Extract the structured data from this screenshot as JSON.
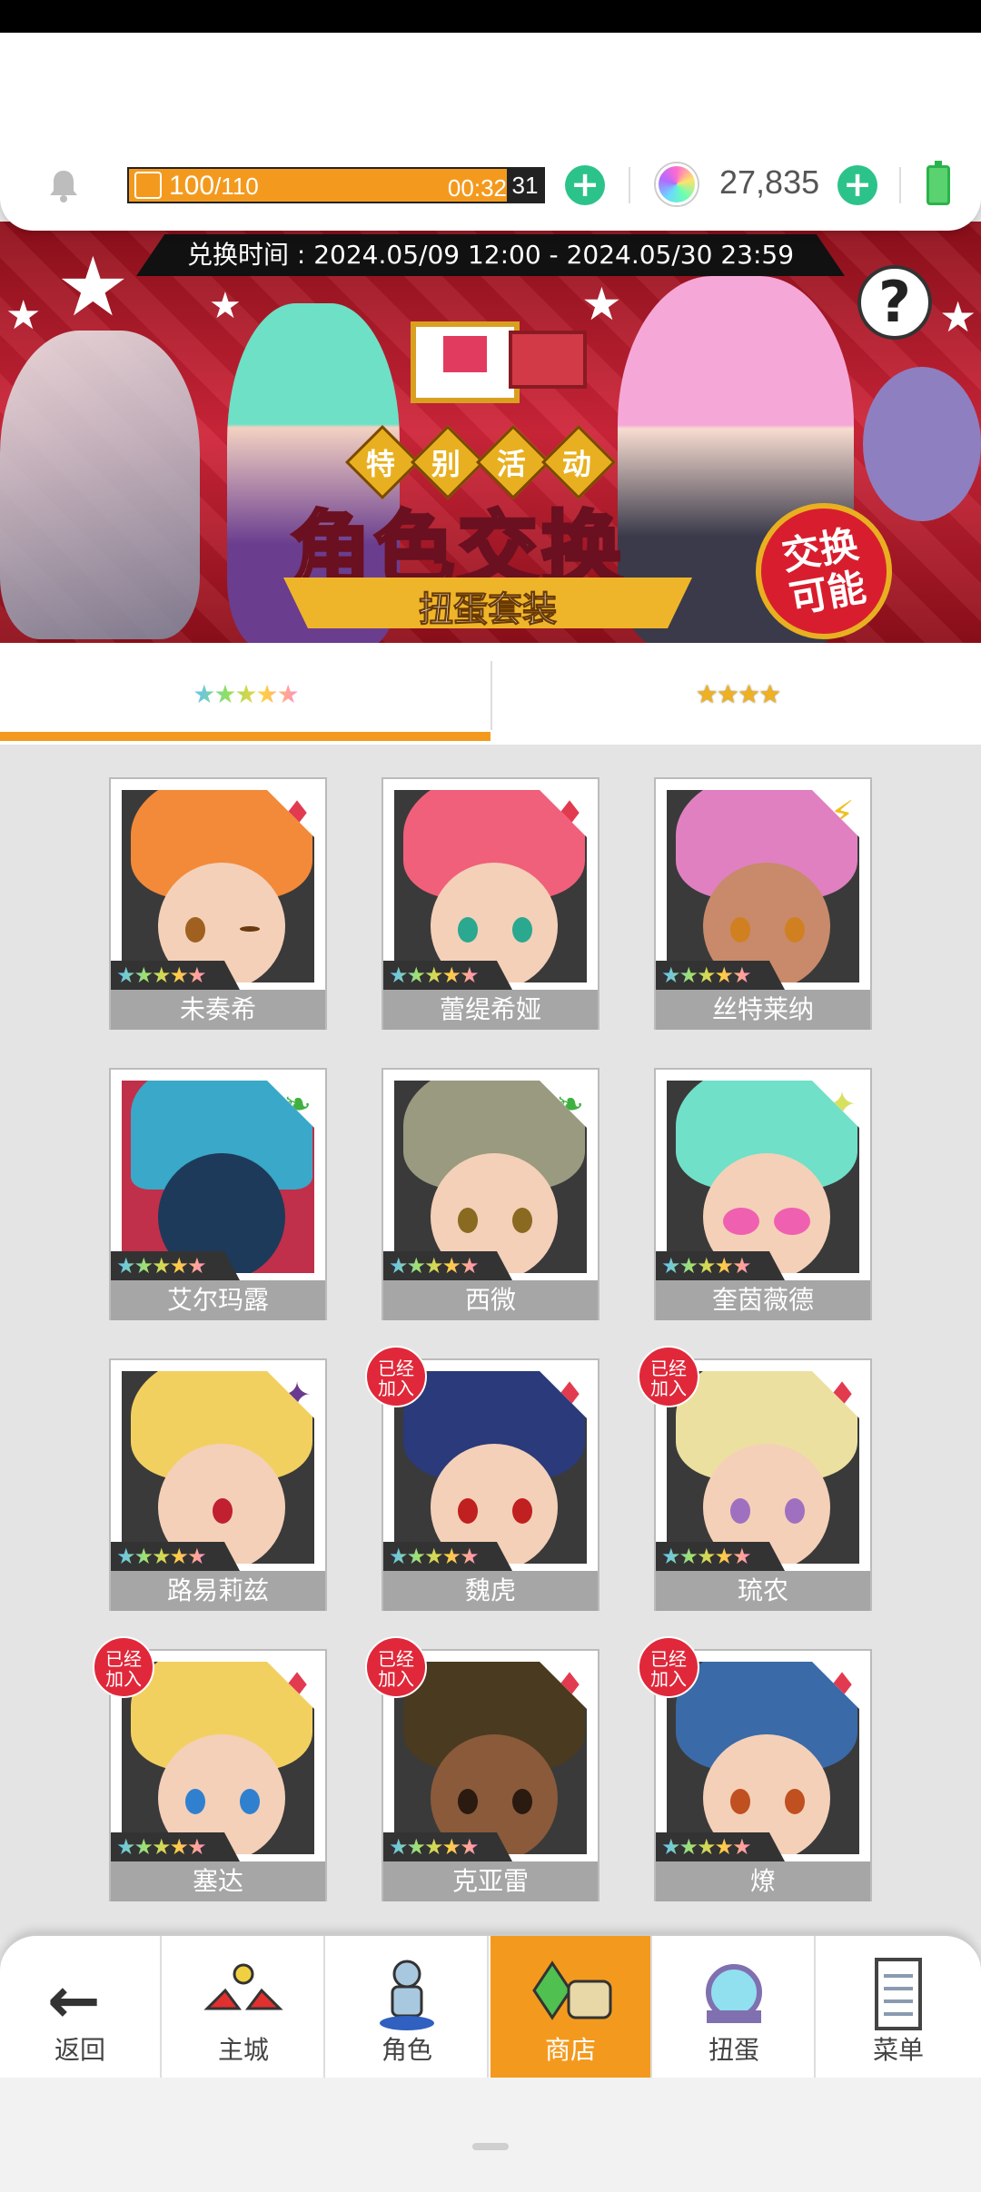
{
  "header": {
    "stamina_current": "100",
    "stamina_max": "/110",
    "stamina_timer": "00:32",
    "stamina_timer_sec": "31",
    "gems": "27,835",
    "stamina_icon": "lightning-icon",
    "notification_icon": "bell-icon",
    "gem_icon": "rainbow-gem-icon",
    "battery_icon": "battery-icon"
  },
  "banner": {
    "exchange_time": "兑换时间 : 2024.05/09 12:00 - 2024.05/30 23:59",
    "tags": [
      "特",
      "别",
      "活",
      "动"
    ],
    "title": "角色交换",
    "subtitle": "扭蛋套装",
    "badge_line1": "交换",
    "badge_line2": "可能",
    "help_label": "?"
  },
  "tabs": [
    {
      "label": "★★★★★",
      "rarity": 5,
      "active": true
    },
    {
      "label": "★★★★",
      "rarity": 4,
      "active": false
    }
  ],
  "characters": [
    {
      "name": "未奏希",
      "stars": "★★★★★",
      "element": "♦",
      "joined": false
    },
    {
      "name": "蕾缇希娅",
      "stars": "★★★★★",
      "element": "♦",
      "joined": false
    },
    {
      "name": "丝特莱纳",
      "stars": "★★★★★",
      "element": "⚡",
      "joined": false
    },
    {
      "name": "艾尔玛露",
      "stars": "★★★★★",
      "element": "❧",
      "joined": false
    },
    {
      "name": "西微",
      "stars": "★★★★★",
      "element": "❧",
      "joined": false
    },
    {
      "name": "奎茵薇德",
      "stars": "★★★★★",
      "element": "✦",
      "joined": false
    },
    {
      "name": "路易莉兹",
      "stars": "★★★★★",
      "element": "✦",
      "joined": false
    },
    {
      "name": "魏虎",
      "stars": "★★★★★",
      "element": "♦",
      "joined": true,
      "joined_label": "已经加入"
    },
    {
      "name": "琉农",
      "stars": "★★★★★",
      "element": "♦",
      "joined": true,
      "joined_label": "已经加入"
    },
    {
      "name": "塞达",
      "stars": "★★★★★",
      "element": "♦",
      "joined": true,
      "joined_label": "已经加入"
    },
    {
      "name": "克亚雷",
      "stars": "★★★★★",
      "element": "♦",
      "joined": true,
      "joined_label": "已经加入"
    },
    {
      "name": "燎",
      "stars": "★★★★★",
      "element": "♦",
      "joined": true,
      "joined_label": "已经加入"
    }
  ],
  "joined_line1": "已经",
  "joined_line2": "加入",
  "navbar": [
    {
      "label": "返回",
      "icon": "back-arrow-icon"
    },
    {
      "label": "主城",
      "icon": "castle-icon"
    },
    {
      "label": "角色",
      "icon": "character-icon"
    },
    {
      "label": "商店",
      "icon": "shop-icon",
      "active": true
    },
    {
      "label": "扭蛋",
      "icon": "gacha-icon"
    },
    {
      "label": "菜单",
      "icon": "menu-list-icon"
    }
  ],
  "colors": {
    "accent": "#f39a1e",
    "plus": "#2cc38a",
    "banner_red": "#d0263a",
    "element_red": "#e23b50",
    "joined_badge": "#e0283a"
  }
}
